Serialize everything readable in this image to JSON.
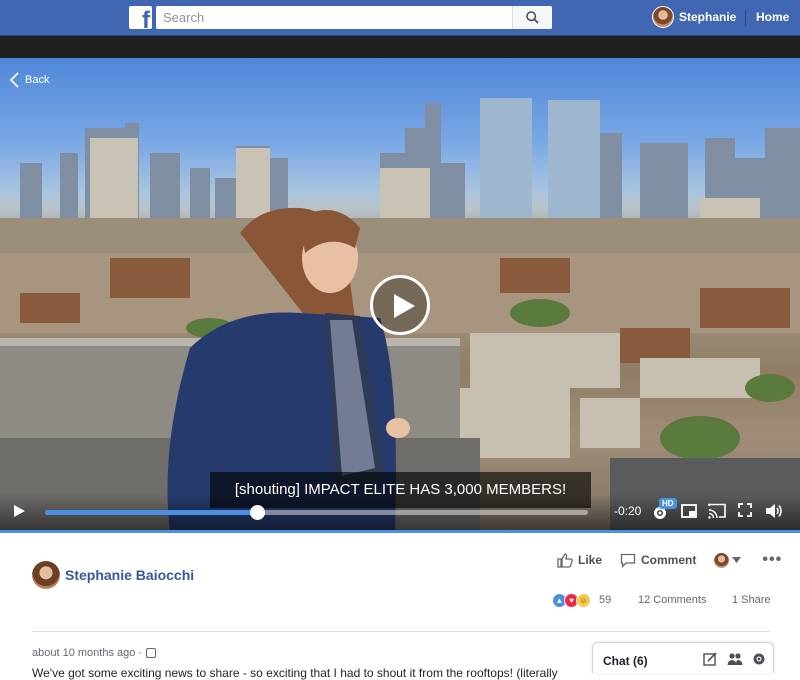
{
  "topbar": {
    "search_placeholder": "Search",
    "user_name": "Stephanie",
    "home_label": "Home"
  },
  "player": {
    "back_label": "Back",
    "caption": "[shouting] IMPACT ELITE HAS 3,000 MEMBERS!",
    "progress": 0.39,
    "time_remaining": "-0:20",
    "hd_badge": "HD"
  },
  "post": {
    "author_name": "Stephanie Baiocchi",
    "actions": {
      "like_label": "Like",
      "comment_label": "Comment"
    },
    "reaction_count": "59",
    "comments_count": "12 Comments",
    "shares_count": "1 Share",
    "timestamp": "about 10 months ago",
    "text_preview": "We've got some exciting news to share - so exciting that I had to shout it from the rooftops! (literally"
  },
  "chat": {
    "label": "Chat (6)"
  },
  "colors": {
    "brand": "#4267b2",
    "link": "#365899",
    "progress": "#4a90e2"
  }
}
